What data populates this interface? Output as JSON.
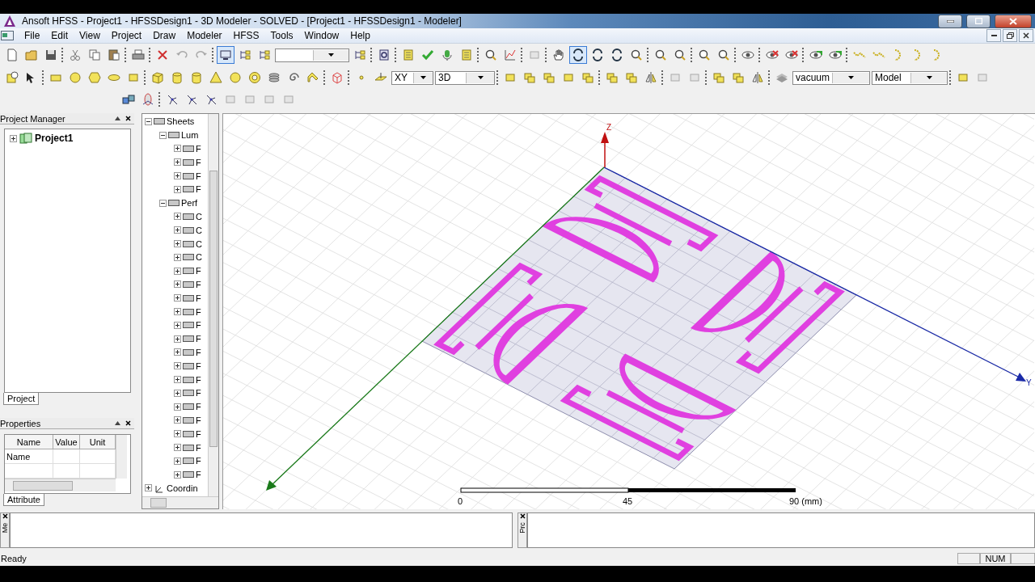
{
  "window": {
    "title": "Ansoft HFSS  - Project1 - HFSSDesign1 - 3D Modeler - SOLVED - [Project1 - HFSSDesign1 - Modeler]"
  },
  "menu": [
    "File",
    "Edit",
    "View",
    "Project",
    "Draw",
    "Modeler",
    "HFSS",
    "Tools",
    "Window",
    "Help"
  ],
  "toolbar": {
    "dropdowns": [
      {
        "value": "XY"
      },
      {
        "value": "3D"
      },
      {
        "value": "vacuum"
      },
      {
        "value": "Model"
      }
    ]
  },
  "project_manager": {
    "title": "Project Manager",
    "tree": [
      {
        "label": "Project1",
        "expanded": false
      }
    ],
    "tab": "Project"
  },
  "properties": {
    "title": "Properties",
    "columns": [
      "Name",
      "Value",
      "Unit"
    ],
    "rows": [
      {
        "name": "Name"
      }
    ],
    "tab": "Attribute"
  },
  "model_tree": {
    "items": [
      {
        "label": "Sheets",
        "kind": "sheet",
        "expanded": true,
        "children": [
          {
            "label": "Lum",
            "kind": "sheet",
            "expanded": true,
            "children": [
              {
                "label": "F",
                "kind": "sheet",
                "expanded": false
              },
              {
                "label": "F",
                "kind": "sheet",
                "expanded": false
              },
              {
                "label": "F",
                "kind": "sheet",
                "expanded": false
              },
              {
                "label": "F",
                "kind": "sheet",
                "expanded": false
              }
            ]
          },
          {
            "label": "Perf",
            "kind": "sheet",
            "expanded": true,
            "children": [
              {
                "label": "C",
                "kind": "sheet",
                "expanded": false
              },
              {
                "label": "C",
                "kind": "sheet",
                "expanded": false
              },
              {
                "label": "C",
                "kind": "sheet",
                "expanded": false
              },
              {
                "label": "C",
                "kind": "sheet",
                "expanded": false
              },
              {
                "label": "F",
                "kind": "sheet",
                "expanded": false
              },
              {
                "label": "F",
                "kind": "sheet",
                "expanded": false
              },
              {
                "label": "F",
                "kind": "sheet",
                "expanded": false
              },
              {
                "label": "F",
                "kind": "sheet",
                "expanded": false
              },
              {
                "label": "F",
                "kind": "sheet",
                "expanded": false
              },
              {
                "label": "F",
                "kind": "sheet",
                "expanded": false
              },
              {
                "label": "F",
                "kind": "sheet",
                "expanded": false
              },
              {
                "label": "F",
                "kind": "sheet",
                "expanded": false
              },
              {
                "label": "F",
                "kind": "sheet",
                "expanded": false
              },
              {
                "label": "F",
                "kind": "sheet",
                "expanded": false
              },
              {
                "label": "F",
                "kind": "sheet",
                "expanded": false
              },
              {
                "label": "F",
                "kind": "sheet",
                "expanded": false
              },
              {
                "label": "F",
                "kind": "sheet",
                "expanded": false
              },
              {
                "label": "F",
                "kind": "sheet",
                "expanded": false
              },
              {
                "label": "F",
                "kind": "sheet",
                "expanded": false
              },
              {
                "label": "F",
                "kind": "sheet",
                "expanded": false
              }
            ]
          }
        ]
      },
      {
        "label": "Coordin",
        "kind": "coordinates",
        "expanded": false
      }
    ]
  },
  "viewport": {
    "axes": [
      {
        "label": "Z"
      },
      {
        "label": "Y"
      }
    ],
    "scale_bar": {
      "labels": [
        "0",
        "45",
        "90 (mm)"
      ]
    }
  },
  "message_panes": [
    {
      "label": "Me"
    },
    {
      "label": "Prc"
    }
  ],
  "status_bar": {
    "text": "Ready",
    "indicators": [
      {
        "label": "NUM"
      }
    ]
  }
}
